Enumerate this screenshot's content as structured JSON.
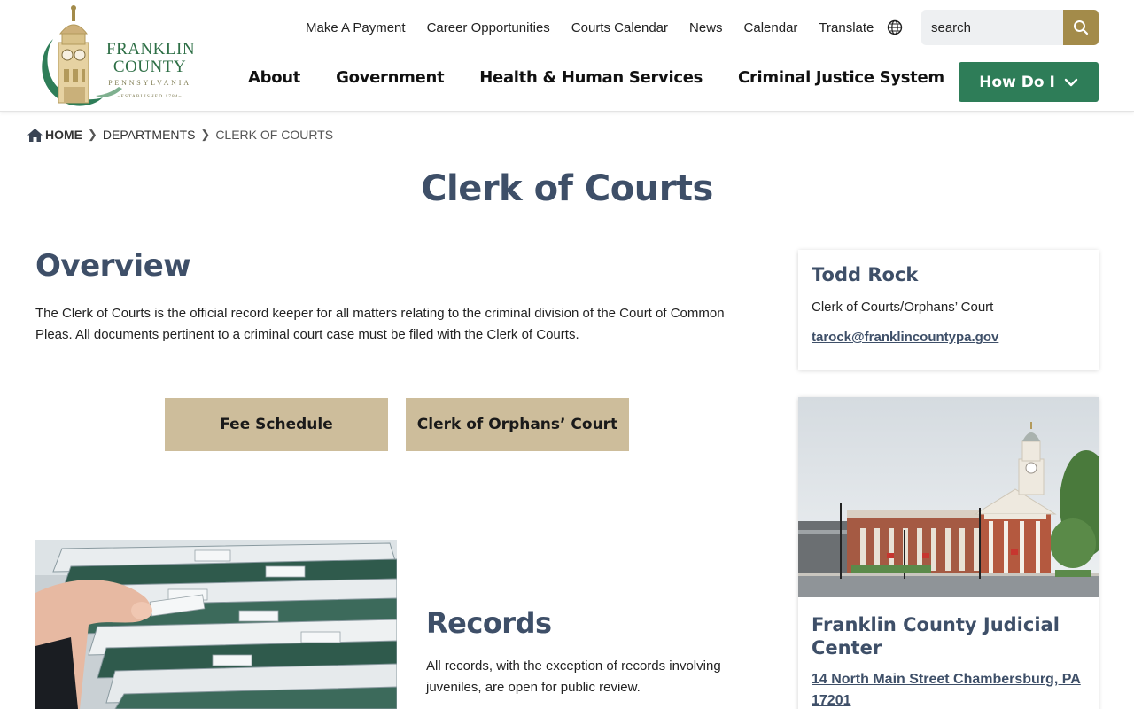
{
  "logo": {
    "line1": "FRANKLIN",
    "line2": "COUNTY",
    "line3": "PENNSYLVANIA",
    "line4": "~ESTABLISHED 1784~"
  },
  "utility_nav": [
    "Make A Payment",
    "Career Opportunities",
    "Courts Calendar",
    "News",
    "Calendar",
    "Translate"
  ],
  "search": {
    "placeholder": "search"
  },
  "main_nav": [
    "About",
    "Government",
    "Health & Human Services",
    "Criminal Justice System"
  ],
  "how_do_i": {
    "label": "How Do I"
  },
  "breadcrumb": {
    "home": "Home",
    "departments": "Departments",
    "current": "Clerk of Courts"
  },
  "page": {
    "title": "Clerk of Courts"
  },
  "overview": {
    "heading": "Overview",
    "text": "The Clerk of Courts is the official record keeper for all matters relating to the criminal division of the Court of Common Pleas. All documents pertinent to a criminal court case must be filed with the Clerk of Courts."
  },
  "buttons": {
    "fee_schedule": "Fee Schedule",
    "orphans_court": "Clerk of Orphans’ Court"
  },
  "records": {
    "heading": "Records",
    "text": "All records, with the exception of records involving juveniles, are open for public review."
  },
  "contact": {
    "name": "Todd Rock",
    "title": "Clerk of Courts/Orphans’ Court",
    "email": "tarock@franklincountypa.gov"
  },
  "location": {
    "name": "Franklin County Judicial Center",
    "address": "14 North Main Street Chambersburg, PA 17201"
  },
  "colors": {
    "heading": "#3e4f68",
    "brand_green": "#2e7d58",
    "gold": "#a38b4a",
    "tan_button": "#cdbd9b"
  }
}
